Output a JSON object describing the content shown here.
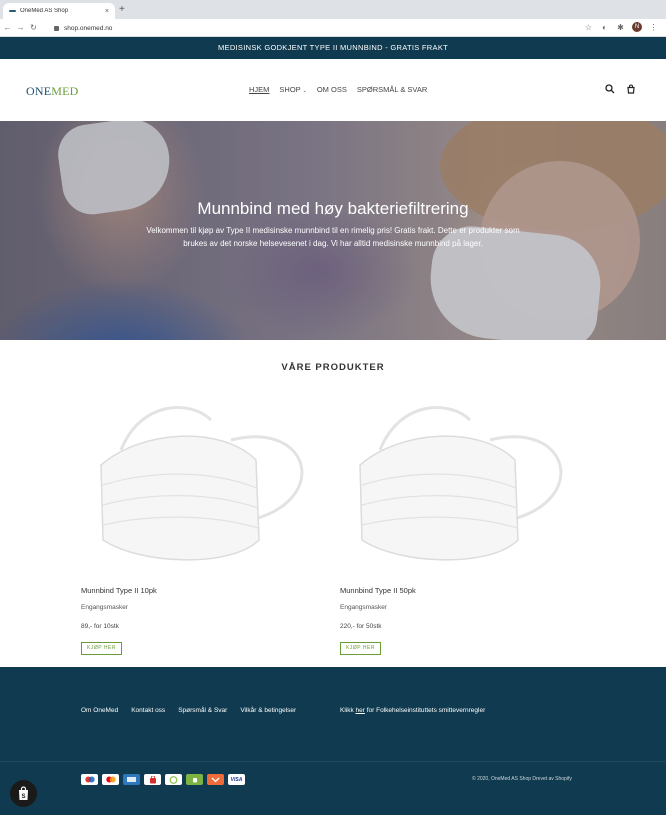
{
  "browser": {
    "tab_title": "OneMed AS Shop",
    "tab_close": "×",
    "new_tab": "+",
    "url": "shop.onemed.no",
    "avatar_letter": "N",
    "icons": [
      "back-icon",
      "forward-icon",
      "reload-icon",
      "lock-icon",
      "star-icon",
      "extension-icon",
      "puzzle-icon",
      "menu-icon"
    ]
  },
  "announcement": "MEDISINSK GODKJENT TYPE II MUNNBIND - GRATIS FRAKT",
  "header": {
    "logo_part1": "ONE",
    "logo_part2": "MED",
    "nav": {
      "home": "HJEM",
      "shop": "SHOP",
      "about": "OM OSS",
      "faq": "SPØRSMÅL & SVAR"
    },
    "icons": [
      "search-icon",
      "cart-icon"
    ]
  },
  "hero": {
    "title": "Munnbind med høy bakteriefiltrering",
    "text": "Velkommen til kjøp av Type II medisinske munnbind til en rimelig pris! Gratis frakt. Dette er produkter som brukes av det norske helsevesenet i dag. Vi har alltid medisinske munnbind på lager."
  },
  "products": {
    "title": "VÅRE PRODUKTER",
    "items": [
      {
        "name": "Munnbind Type II 10pk",
        "vendor": "Engangsmasker",
        "price": "89,- for 10stk",
        "button": "KJØP HER"
      },
      {
        "name": "Munnbind Type II 50pk",
        "vendor": "Engangsmasker",
        "price": "220,- for 50stk",
        "button": "KJØP HER"
      }
    ]
  },
  "footer": {
    "links": [
      "Om OneMed",
      "Kontakt oss",
      "Spørsmål & Svar",
      "Vilkår & betingelser"
    ],
    "note_prefix": "Klikk ",
    "note_link": "her",
    "note_suffix": " for Folkehelseinstituttets smittevernregler",
    "payments": [
      "maestro",
      "mastercard",
      "amex",
      "apple-pay",
      "diners",
      "google-pay",
      "klarna",
      "visa"
    ],
    "visa_label": "VISA",
    "copyright": "© 2020, OneMed AS Shop Drevet av Shopify"
  },
  "colors": {
    "brand_dark": "#0f3a4f",
    "brand_green": "#6b9c3a"
  }
}
